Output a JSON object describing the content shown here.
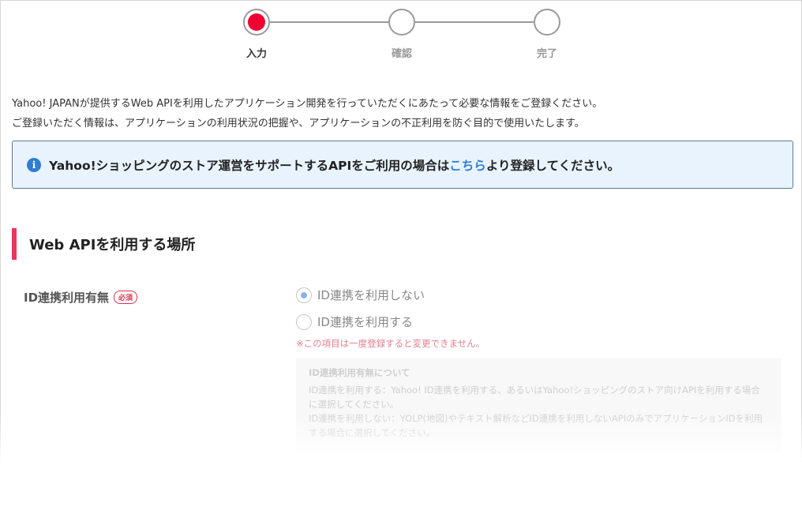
{
  "stepper": {
    "steps": [
      {
        "label": "入力",
        "active": true
      },
      {
        "label": "確認",
        "active": false
      },
      {
        "label": "完了",
        "active": false
      }
    ]
  },
  "intro": {
    "line1": "Yahoo! JAPANが提供するWeb APIを利用したアプリケーション開発を行っていただくにあたって必要な情報をご登録ください。",
    "line2": "ご登録いただく情報は、アプリケーションの利用状況の把握や、アプリケーションの不正利用を防ぐ目的で使用いたします。"
  },
  "notice": {
    "icon": "info-icon",
    "text_before": "Yahoo!ショッピングのストア運営をサポートするAPIをご利用の場合は",
    "link_text": "こちら",
    "text_after": "より登録してください。"
  },
  "section": {
    "title": "Web APIを利用する場所"
  },
  "id_field": {
    "label": "ID連携利用有無",
    "required_badge": "必須",
    "options": [
      {
        "label": "ID連携を利用しない",
        "checked": true
      },
      {
        "label": "ID連携を利用する",
        "checked": false
      }
    ],
    "warning": "※この項目は一度登録すると変更できません。",
    "help": {
      "title": "ID連携利用有無について",
      "line1": "ID連携を利用する：Yahoo! ID連携を利用する、あるいはYahoo!ショッピングのストア向けAPIを利用する場合に選択してください。",
      "line2": "ID連携を利用しない：YOLP(地図)やテキスト解析などID連携を利用しないAPIのみでアプリケーションIDを利用する場合に選択してください。"
    }
  },
  "colors": {
    "active_step": "#ee0033",
    "section_accent": "#e8385a",
    "link": "#2f7ed0",
    "notice_bg": "#e8f3fd"
  }
}
